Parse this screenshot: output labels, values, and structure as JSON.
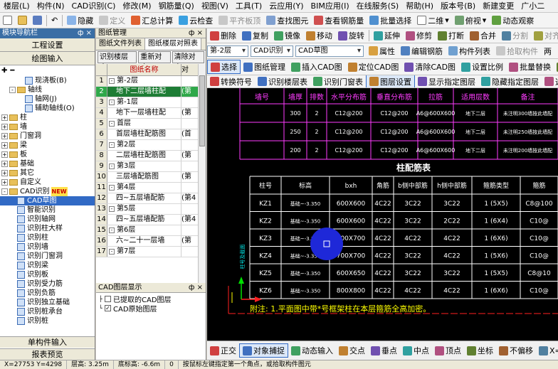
{
  "menu": [
    "楼层(L)",
    "构件(N)",
    "CAD识别(C)",
    "修改(M)",
    "钢筋量(Q)",
    "视图(V)",
    "工具(T)",
    "云应用(Y)",
    "BIM应用(I)",
    "在线服务(S)",
    "帮助(H)",
    "版本号(B)",
    "新建变更",
    "广小二"
  ],
  "toolbar1": {
    "hide": "隐藏",
    "define": "定义",
    "sum": "汇总计算",
    "cloud_check": "云检查",
    "flat_top": "平齐板顶",
    "find": "查找图元",
    "view_rebar": "查看钢筋量",
    "batch_select": "批量选择",
    "view_mode": "二维",
    "view_angle": "俯视",
    "dyn_view": "动态观察"
  },
  "nav": {
    "title": "模块导航栏",
    "pin": "ф ×",
    "project_settings": "工程设置",
    "drawing_input": "绘图输入",
    "tree": [
      {
        "label": "现浇板(B)",
        "level": 2,
        "kind": "item"
      },
      {
        "label": "轴线",
        "level": 1,
        "kind": "folder",
        "exp": "-"
      },
      {
        "label": "轴网(J)",
        "level": 2,
        "kind": "item"
      },
      {
        "label": "辅助轴线(O)",
        "level": 2,
        "kind": "item"
      },
      {
        "label": "柱",
        "level": 0,
        "kind": "folder",
        "exp": "+"
      },
      {
        "label": "墙",
        "level": 0,
        "kind": "folder",
        "exp": "+"
      },
      {
        "label": "门窗洞",
        "level": 0,
        "kind": "folder",
        "exp": "+"
      },
      {
        "label": "梁",
        "level": 0,
        "kind": "folder",
        "exp": "+"
      },
      {
        "label": "板",
        "level": 0,
        "kind": "folder",
        "exp": "+"
      },
      {
        "label": "基础",
        "level": 0,
        "kind": "folder",
        "exp": "+"
      },
      {
        "label": "其它",
        "level": 0,
        "kind": "folder",
        "exp": "+"
      },
      {
        "label": "自定义",
        "level": 0,
        "kind": "folder",
        "exp": "+"
      },
      {
        "label": "CAD识别",
        "level": 0,
        "kind": "folder",
        "exp": "-",
        "badge": "NEW"
      },
      {
        "label": "CAD草图",
        "level": 1,
        "kind": "item",
        "selected": true
      },
      {
        "label": "智能识别",
        "level": 1,
        "kind": "item"
      },
      {
        "label": "识别轴网",
        "level": 1,
        "kind": "item"
      },
      {
        "label": "识别柱大样",
        "level": 1,
        "kind": "item"
      },
      {
        "label": "识别柱",
        "level": 1,
        "kind": "item"
      },
      {
        "label": "识别墙",
        "level": 1,
        "kind": "item"
      },
      {
        "label": "识别门窗洞",
        "level": 1,
        "kind": "item"
      },
      {
        "label": "识别梁",
        "level": 1,
        "kind": "item"
      },
      {
        "label": "识别板",
        "level": 1,
        "kind": "item"
      },
      {
        "label": "识别受力筋",
        "level": 1,
        "kind": "item"
      },
      {
        "label": "识别负筋",
        "level": 1,
        "kind": "item"
      },
      {
        "label": "识别独立基础",
        "level": 1,
        "kind": "item"
      },
      {
        "label": "识别桩承台",
        "level": 1,
        "kind": "item"
      },
      {
        "label": "识别桩",
        "level": 1,
        "kind": "item"
      }
    ],
    "single_input": "单构件输入",
    "report_preview": "报表预览"
  },
  "drawing_manager": {
    "title": "图纸管理",
    "pin": "ф ×",
    "tabs": [
      "图纸文件列表",
      "图纸楼层对照表"
    ],
    "buttons": [
      "识别楼层表",
      "重新对应",
      "清除对应"
    ],
    "col_name": "图纸名称",
    "col_scale": "对",
    "rows": [
      {
        "n": "1",
        "name": "第-2层",
        "mark": "-",
        "sub": false,
        "scale": ""
      },
      {
        "n": "2",
        "name": "地下二层墙柱配",
        "mark": "",
        "sub": true,
        "scale": "(第",
        "hl": true
      },
      {
        "n": "3",
        "name": "第-1层",
        "mark": "-",
        "sub": false,
        "scale": ""
      },
      {
        "n": "4",
        "name": "地下一层墙柱配",
        "mark": "",
        "sub": true,
        "scale": "(第"
      },
      {
        "n": "5",
        "name": "首层",
        "mark": "-",
        "sub": false,
        "scale": ""
      },
      {
        "n": "6",
        "name": "首层墙柱配筋图",
        "mark": "",
        "sub": true,
        "scale": "(首"
      },
      {
        "n": "7",
        "name": "第2层",
        "mark": "-",
        "sub": false,
        "scale": ""
      },
      {
        "n": "8",
        "name": "二层墙柱配筋图",
        "mark": "",
        "sub": true,
        "scale": "(第"
      },
      {
        "n": "9",
        "name": "第3层",
        "mark": "-",
        "sub": false,
        "scale": ""
      },
      {
        "n": "10",
        "name": "三层墙配筋图",
        "mark": "",
        "sub": true,
        "scale": "(第"
      },
      {
        "n": "11",
        "name": "第4层",
        "mark": "-",
        "sub": false,
        "scale": ""
      },
      {
        "n": "12",
        "name": "四~五层墙配筋",
        "mark": "",
        "sub": true,
        "scale": "(第4"
      },
      {
        "n": "13",
        "name": "第5层",
        "mark": "-",
        "sub": false,
        "scale": ""
      },
      {
        "n": "14",
        "name": "四~五层墙配筋",
        "mark": "",
        "sub": true,
        "scale": "(第4"
      },
      {
        "n": "15",
        "name": "第6层",
        "mark": "-",
        "sub": false,
        "scale": ""
      },
      {
        "n": "16",
        "name": "六~二十一层墙",
        "mark": "",
        "sub": true,
        "scale": "(第"
      },
      {
        "n": "17",
        "name": "第7层",
        "mark": "-",
        "sub": false,
        "scale": ""
      }
    ]
  },
  "layers": {
    "title": "CAD图层显示",
    "items": [
      {
        "label": "已提取的CAD图层",
        "checked": false
      },
      {
        "label": "CAD原始图层",
        "checked": true
      }
    ]
  },
  "sub1": [
    "删除",
    "复制",
    "镜像",
    "移动",
    "旋转",
    "延伸",
    "修剪",
    "打断",
    "合并",
    "分割",
    "对齐"
  ],
  "sub2": {
    "floor": "第-2层",
    "mode": "CAD识别",
    "draft": "CAD草图",
    "attr": "属性",
    "edit_rebar": "编辑钢筋",
    "comp_list": "构件列表",
    "pick": "拾取构件",
    "two": "两"
  },
  "sub3": [
    "选择",
    "图纸管理",
    "插入CAD图",
    "定位CAD图",
    "清除CAD图",
    "设置比例",
    "批量替换",
    "还"
  ],
  "sub4": [
    "转换符号",
    "识别楼层表",
    "识别门窗表",
    "图层设置",
    "显示指定图层",
    "隐藏指定图层",
    "选择同"
  ],
  "upper_table": {
    "headers": [
      "墙号",
      "墙厚",
      "排数",
      "水平分布筋",
      "垂直分布筋",
      "拉筋",
      "适用层数",
      "备注"
    ],
    "rows": [
      [
        "300",
        "2",
        "C12@200",
        "C12@200",
        "A6@600X600",
        "地下二层",
        "未注明300墙按此墙配"
      ],
      [
        "250",
        "2",
        "C12@200",
        "C12@200",
        "A6@600X600",
        "地下二层",
        "未注明250墙按此墙配"
      ],
      [
        "200",
        "2",
        "C12@200",
        "C12@200",
        "A6@600X600",
        "地下二层",
        "未注明200墙按此墙配"
      ]
    ]
  },
  "column_table": {
    "title": "柱配筋表",
    "headers": [
      "柱号",
      "标高",
      "bxh",
      "角筋",
      "b侧中部筋",
      "h侧中部筋",
      "箍筋类型",
      "箍筋"
    ],
    "rows": [
      [
        "KZ1",
        "基础~-3.350",
        "600X600",
        "4C22",
        "3C22",
        "3C22",
        "1 (5X5)",
        "C8@100"
      ],
      [
        "KZ2",
        "基础~-3.350",
        "600X600",
        "4C22",
        "3C22",
        "2C22",
        "1 (6X4)",
        "C10@"
      ],
      [
        "KZ3",
        "基础~-3.350",
        "700X700",
        "4C22",
        "4C22",
        "4C22",
        "1 (6X6)",
        "C10@"
      ],
      [
        "KZ4",
        "基础~-3.350",
        "700X700",
        "4C22",
        "3C22",
        "4C22",
        "1 (5X6)",
        "C10@"
      ],
      [
        "KZ5",
        "基础~-3.350",
        "600X650",
        "4C22",
        "3C22",
        "3C22",
        "1 (5X5)",
        "C8@10"
      ],
      [
        "KZ6",
        "基础~-3.350",
        "800X800",
        "4C22",
        "4C22",
        "4C22",
        "1 (6X6)",
        "C10@"
      ]
    ],
    "note": "附注: 1.平面图中带*号框架柱在本层箍筋全高加密。",
    "side_label": "柱号及截面"
  },
  "status2": [
    "正交",
    "对象捕捉",
    "动态输入",
    "交点",
    "垂点",
    "中点",
    "顶点",
    "坐标",
    "不偏移",
    "X="
  ],
  "statusbar": {
    "coords": "X=27753  Y=4298",
    "floor_h": "层高: 3.25m",
    "base_h": "底标高: -6.6m",
    "zero": "0",
    "hint": "按鼠标左键指定第一个角点，或拾取构件图元"
  },
  "colors": {
    "nav_title": "#3a6ea5",
    "highlight_row": "#2fa84a",
    "canvas": "#000000",
    "cad_magenta": "#ff3cff",
    "cad_cyan": "#00e6e6",
    "cad_red": "#ff2020",
    "cad_yellow": "#ffff00",
    "cursor": "#1e28d8"
  }
}
